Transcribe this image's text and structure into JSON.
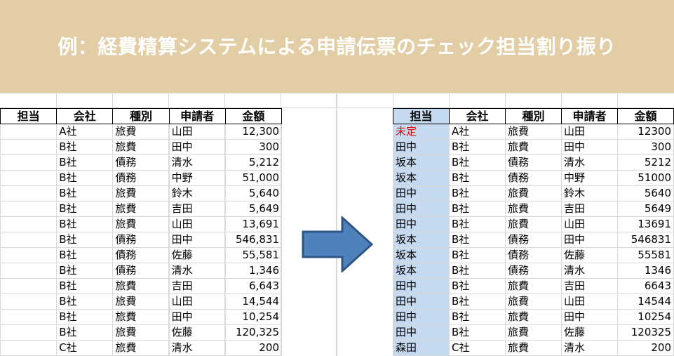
{
  "banner": {
    "title": "例：経費精算システムによる申請伝票のチェック担当割り振り"
  },
  "colors": {
    "banner_bg": "#e3cda5",
    "assignee_bg": "#c5d9f0",
    "unassigned_text": "#e00000",
    "arrow_fill": "#4f81bd"
  },
  "arrow": {
    "icon": "right-arrow-icon"
  },
  "left_table": {
    "headers": [
      "担当",
      "会社",
      "種別",
      "申請者",
      "金額"
    ],
    "rows": [
      [
        "",
        "A社",
        "旅費",
        "山田",
        "12,300"
      ],
      [
        "",
        "B社",
        "旅費",
        "田中",
        "300"
      ],
      [
        "",
        "B社",
        "債務",
        "清水",
        "5,212"
      ],
      [
        "",
        "B社",
        "債務",
        "中野",
        "51,000"
      ],
      [
        "",
        "B社",
        "旅費",
        "鈴木",
        "5,640"
      ],
      [
        "",
        "B社",
        "旅費",
        "吉田",
        "5,649"
      ],
      [
        "",
        "B社",
        "旅費",
        "山田",
        "13,691"
      ],
      [
        "",
        "B社",
        "債務",
        "田中",
        "546,831"
      ],
      [
        "",
        "B社",
        "債務",
        "佐藤",
        "55,581"
      ],
      [
        "",
        "B社",
        "債務",
        "清水",
        "1,346"
      ],
      [
        "",
        "B社",
        "旅費",
        "吉田",
        "6,643"
      ],
      [
        "",
        "B社",
        "旅費",
        "山田",
        "14,544"
      ],
      [
        "",
        "B社",
        "旅費",
        "田中",
        "10,254"
      ],
      [
        "",
        "B社",
        "旅費",
        "佐藤",
        "120,325"
      ],
      [
        "",
        "C社",
        "旅費",
        "清水",
        "200"
      ]
    ]
  },
  "right_table": {
    "headers": [
      "担当",
      "会社",
      "種別",
      "申請者",
      "金額"
    ],
    "rows": [
      [
        "未定",
        "A社",
        "旅費",
        "山田",
        "12300"
      ],
      [
        "田中",
        "B社",
        "旅費",
        "田中",
        "300"
      ],
      [
        "坂本",
        "B社",
        "債務",
        "清水",
        "5212"
      ],
      [
        "坂本",
        "B社",
        "債務",
        "中野",
        "51000"
      ],
      [
        "田中",
        "B社",
        "旅費",
        "鈴木",
        "5640"
      ],
      [
        "田中",
        "B社",
        "旅費",
        "吉田",
        "5649"
      ],
      [
        "田中",
        "B社",
        "旅費",
        "山田",
        "13691"
      ],
      [
        "坂本",
        "B社",
        "債務",
        "田中",
        "546831"
      ],
      [
        "坂本",
        "B社",
        "債務",
        "佐藤",
        "55581"
      ],
      [
        "坂本",
        "B社",
        "債務",
        "清水",
        "1346"
      ],
      [
        "田中",
        "B社",
        "旅費",
        "吉田",
        "6643"
      ],
      [
        "田中",
        "B社",
        "旅費",
        "山田",
        "14544"
      ],
      [
        "田中",
        "B社",
        "旅費",
        "田中",
        "10254"
      ],
      [
        "田中",
        "B社",
        "旅費",
        "佐藤",
        "120325"
      ],
      [
        "森田",
        "C社",
        "旅費",
        "清水",
        "200"
      ]
    ]
  }
}
